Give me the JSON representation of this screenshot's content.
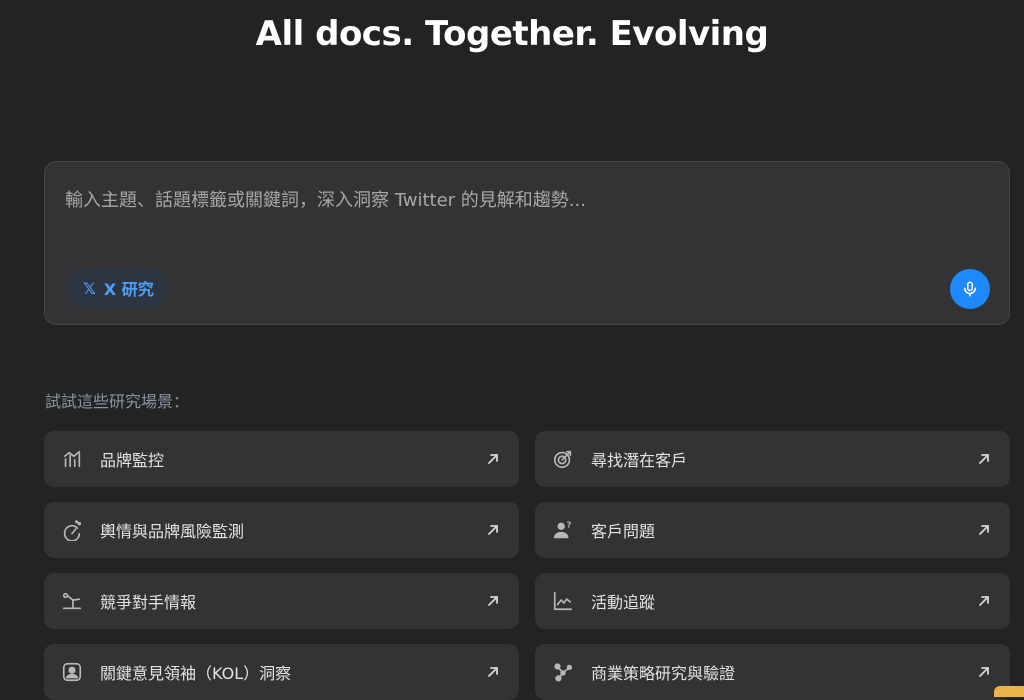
{
  "header": {
    "title": "All docs. Together. Evolving"
  },
  "composer": {
    "placeholder": "輸入主題、話題標籤或關鍵詞，深入洞察 Twitter 的見解和趨勢...",
    "value": "",
    "chip": {
      "glyph": "𝕏",
      "label": "X 研究",
      "icon": "x-logo-icon"
    },
    "mic": {
      "icon": "microphone-icon",
      "color": "#1e88ff"
    }
  },
  "scenarios": {
    "label": "試試這些研究場景：",
    "items": [
      {
        "label": "品牌監控",
        "icon": "bar-chart-icon"
      },
      {
        "label": "尋找潛在客戶",
        "icon": "target-icon"
      },
      {
        "label": "輿情與品牌風險監測",
        "icon": "gauge-icon"
      },
      {
        "label": "客戶問題",
        "icon": "user-question-icon"
      },
      {
        "label": "競爭對手情報",
        "icon": "trend-signal-icon"
      },
      {
        "label": "活動追蹤",
        "icon": "line-chart-icon"
      },
      {
        "label": "關鍵意見領袖（KOL）洞察",
        "icon": "user-portrait-icon"
      },
      {
        "label": "商業策略研究與驗證",
        "icon": "network-icon"
      }
    ]
  },
  "colors": {
    "background": "#232323",
    "card": "#333335",
    "accent": "#1e88ff",
    "chip_text": "#4ea0f8"
  }
}
